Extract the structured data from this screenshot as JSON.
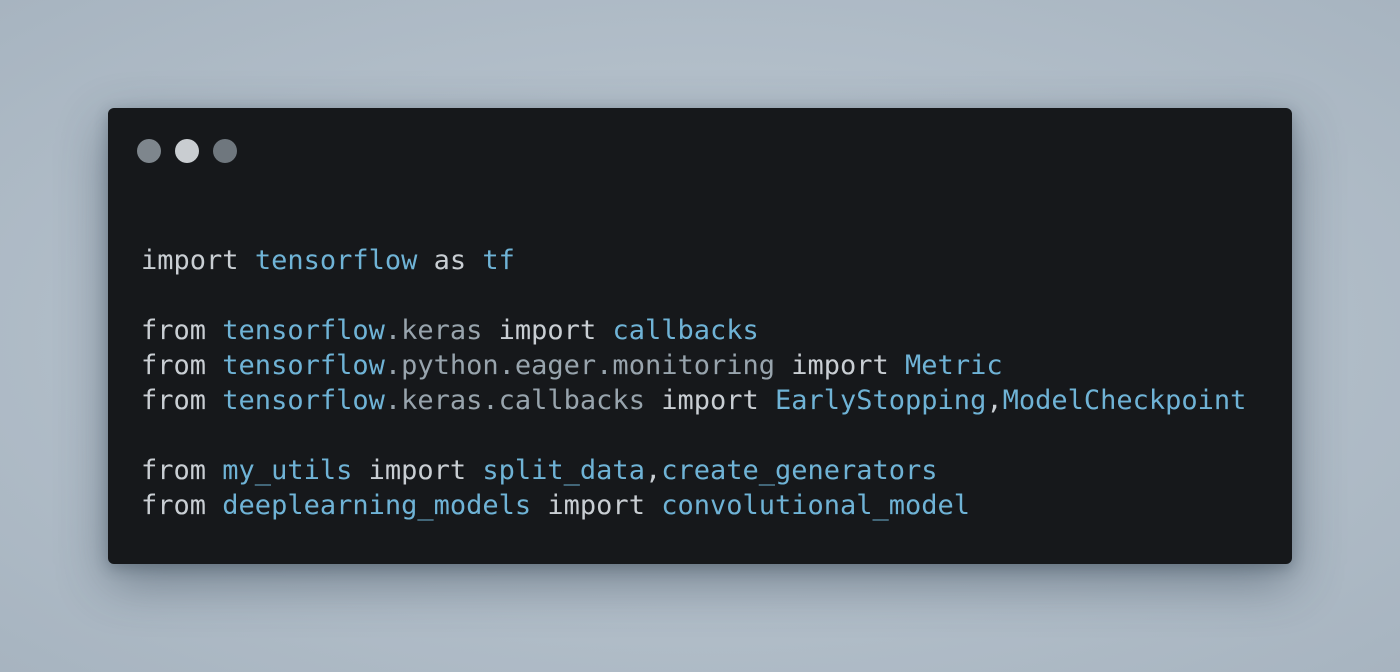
{
  "window": {
    "controls": [
      {
        "name": "close",
        "color": "#7e868d"
      },
      {
        "name": "minimize",
        "color": "#c9cdd1"
      },
      {
        "name": "maximize",
        "color": "#6f777e"
      }
    ]
  },
  "code": {
    "lines": [
      [
        {
          "t": "import",
          "c": "kw"
        },
        {
          "t": " ",
          "c": "kw"
        },
        {
          "t": "tensorflow",
          "c": "mod"
        },
        {
          "t": " as ",
          "c": "kw"
        },
        {
          "t": "tf",
          "c": "name"
        }
      ],
      [],
      [
        {
          "t": "from",
          "c": "kw"
        },
        {
          "t": " ",
          "c": "kw"
        },
        {
          "t": "tensorflow",
          "c": "mod"
        },
        {
          "t": ".keras",
          "c": "sub"
        },
        {
          "t": " import ",
          "c": "kw"
        },
        {
          "t": "callbacks",
          "c": "name"
        }
      ],
      [
        {
          "t": "from",
          "c": "kw"
        },
        {
          "t": " ",
          "c": "kw"
        },
        {
          "t": "tensorflow",
          "c": "mod"
        },
        {
          "t": ".python.eager.monitoring",
          "c": "sub"
        },
        {
          "t": " import ",
          "c": "kw"
        },
        {
          "t": "Metric",
          "c": "name"
        }
      ],
      [
        {
          "t": "from",
          "c": "kw"
        },
        {
          "t": " ",
          "c": "kw"
        },
        {
          "t": "tensorflow",
          "c": "mod"
        },
        {
          "t": ".keras.callbacks",
          "c": "sub"
        },
        {
          "t": " import ",
          "c": "kw"
        },
        {
          "t": "EarlyStopping",
          "c": "name"
        },
        {
          "t": ",",
          "c": "punct"
        },
        {
          "t": "ModelCheckpoint",
          "c": "name"
        }
      ],
      [],
      [
        {
          "t": "from",
          "c": "kw"
        },
        {
          "t": " ",
          "c": "kw"
        },
        {
          "t": "my_utils",
          "c": "mod"
        },
        {
          "t": " import ",
          "c": "kw"
        },
        {
          "t": "split_data",
          "c": "name"
        },
        {
          "t": ",",
          "c": "punct"
        },
        {
          "t": "create_generators",
          "c": "name"
        }
      ],
      [
        {
          "t": "from",
          "c": "kw"
        },
        {
          "t": " ",
          "c": "kw"
        },
        {
          "t": "deeplearning_models",
          "c": "mod"
        },
        {
          "t": " import ",
          "c": "kw"
        },
        {
          "t": "convolutional_model",
          "c": "name"
        }
      ]
    ]
  }
}
